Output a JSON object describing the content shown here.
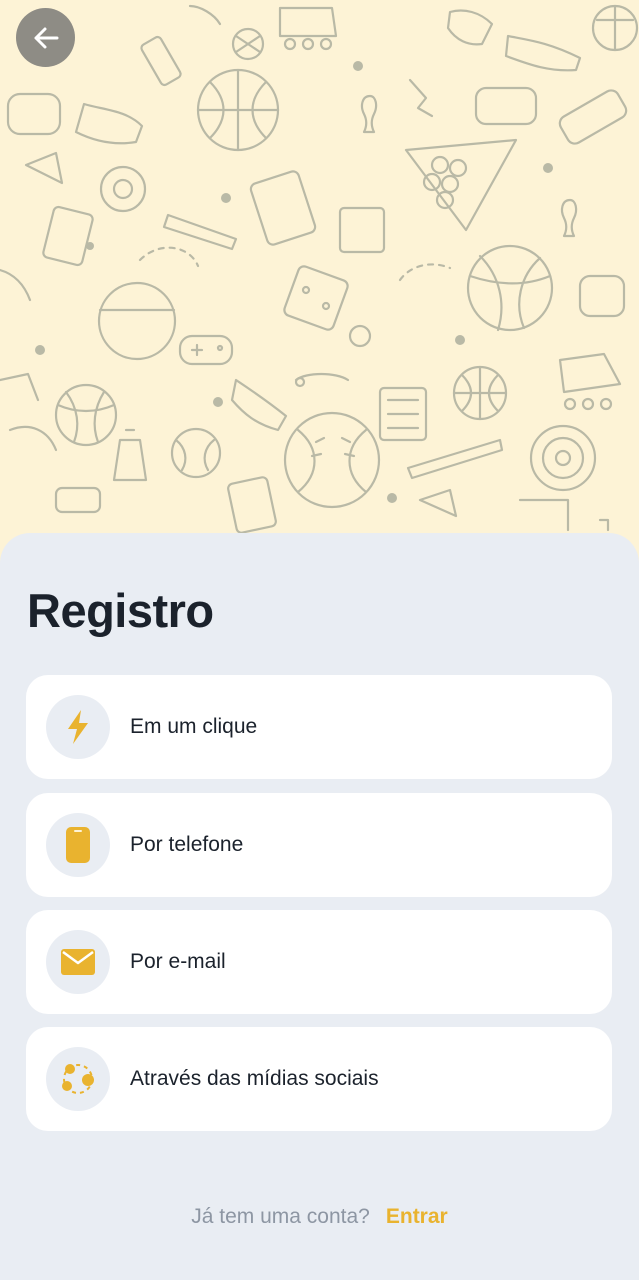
{
  "header": {
    "back_icon": "arrow-left-icon",
    "background_pattern": "sports-doodle-pattern"
  },
  "colors": {
    "accent": "#e9b32f",
    "sheet_bg": "#e9edf3",
    "hero_bg": "#fdf3d6",
    "text": "#1b222c",
    "muted": "#8d96a3"
  },
  "main": {
    "title": "Registro",
    "options": [
      {
        "label": "Em um clique",
        "icon": "lightning-icon"
      },
      {
        "label": "Por telefone",
        "icon": "phone-icon"
      },
      {
        "label": "Por e-mail",
        "icon": "envelope-icon"
      },
      {
        "label": "Através das mídias sociais",
        "icon": "social-network-icon"
      }
    ]
  },
  "footer": {
    "question": "Já tem uma conta?",
    "link": "Entrar"
  }
}
